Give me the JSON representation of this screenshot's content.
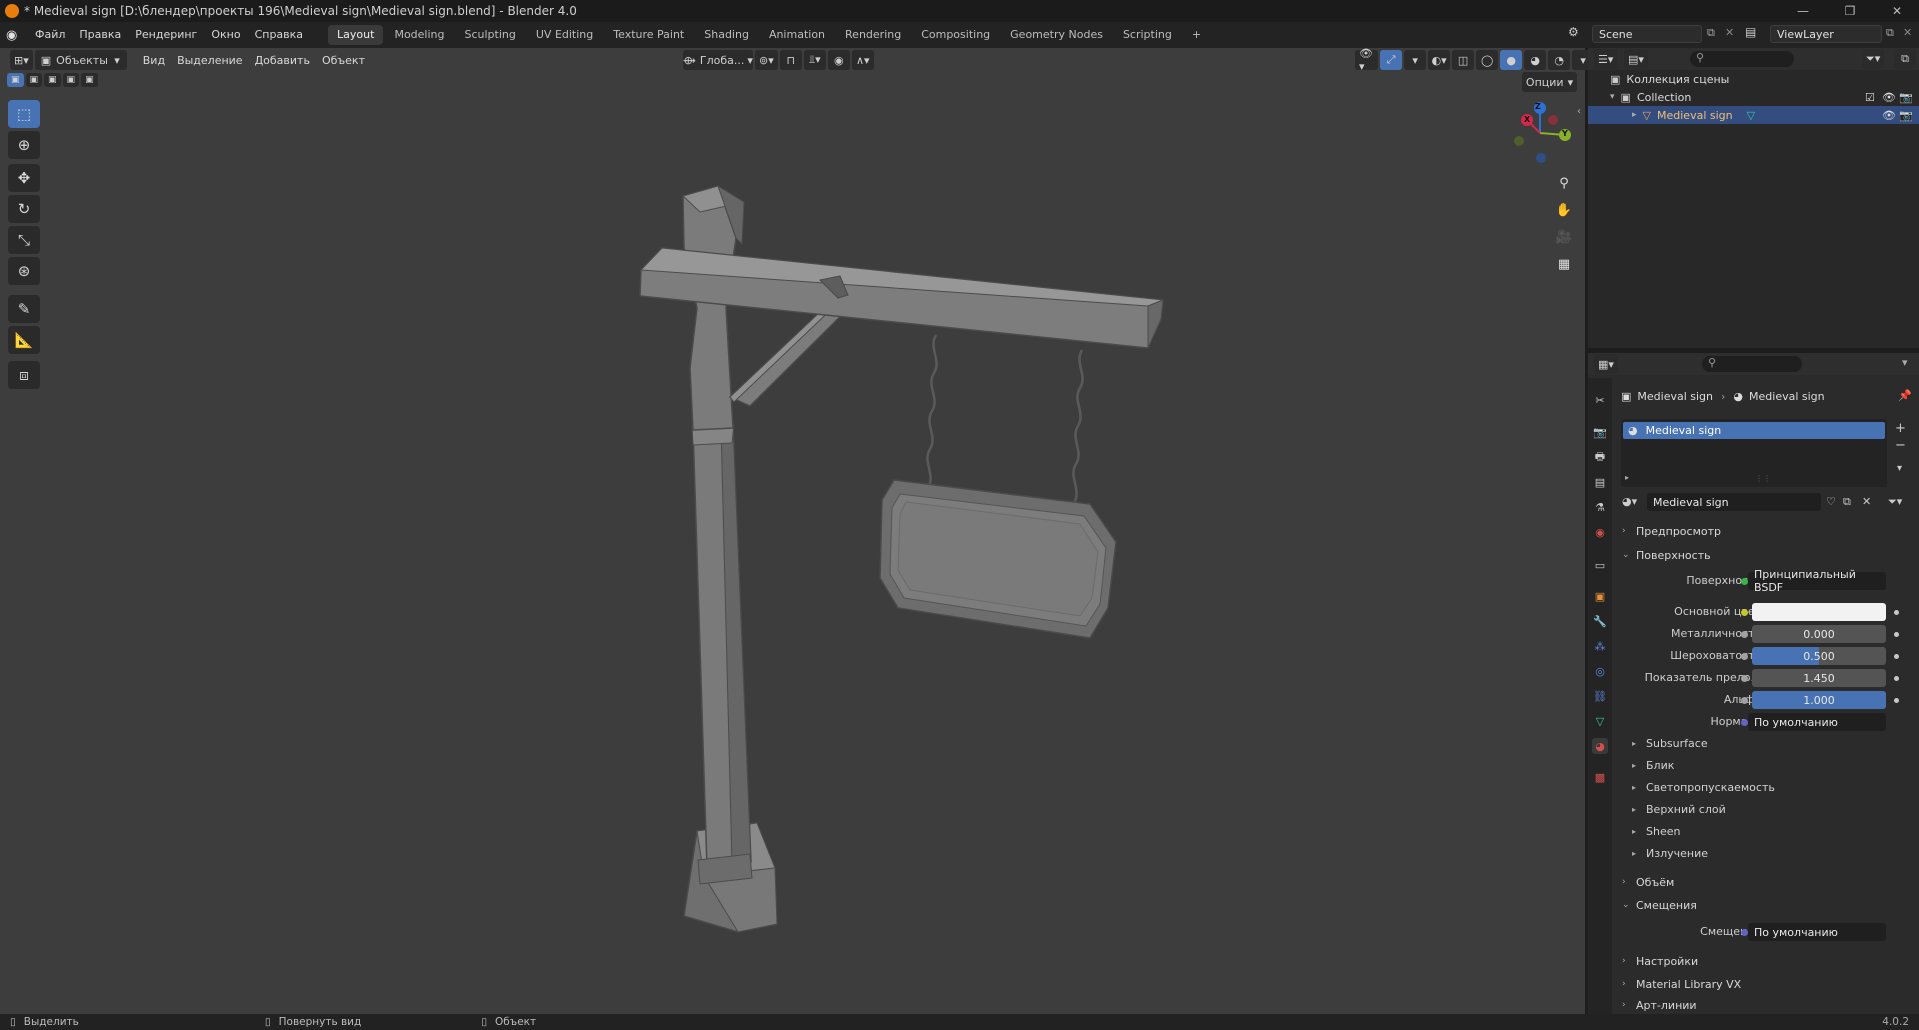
{
  "window": {
    "title": "* Medieval sign [D:\\блендер\\проекты 196\\Medieval sign\\Medieval sign.blend] - Blender 4.0",
    "minimize": "—",
    "maximize": "❐",
    "close": "✕"
  },
  "menu": [
    "Файл",
    "Правка",
    "Рендеринг",
    "Окно",
    "Справка"
  ],
  "workspaces": [
    "Layout",
    "Modeling",
    "Sculpting",
    "UV Editing",
    "Texture Paint",
    "Shading",
    "Animation",
    "Rendering",
    "Compositing",
    "Geometry Nodes",
    "Scripting"
  ],
  "workspace_add": "+",
  "scene": {
    "name": "Scene",
    "view_layer": "ViewLayer"
  },
  "viewport": {
    "mode": "Объекты",
    "menus": [
      "Вид",
      "Выделение",
      "Добавить",
      "Объект"
    ],
    "transform_orientation": "Глоба...",
    "options": "Опции"
  },
  "gizmo": {
    "x": "X",
    "y": "Y",
    "z": "Z"
  },
  "outliner": {
    "search_placeholder": "",
    "scene_collection": "Коллекция сцены",
    "collection": "Collection",
    "object": "Medieval sign"
  },
  "properties": {
    "breadcrumb_object": "Medieval sign",
    "breadcrumb_material": "Medieval sign",
    "slot_name": "Medieval sign",
    "material_name": "Medieval sign",
    "sections": {
      "preview": "Предпросмотр",
      "surface": "Поверхность",
      "volume": "Объём",
      "displacement": "Смещения",
      "settings": "Настройки",
      "material_library": "Material Library VX",
      "lineart": "Арт-линии"
    },
    "surface_label": "Поверхность",
    "surface_value": "Принципиальный BSDF",
    "fields": {
      "base_color": "Основной цвет",
      "metallic_label": "Металличность",
      "metallic": "0.000",
      "roughness_label": "Шероховатость",
      "roughness": "0.500",
      "ior_label": "Показатель прело...",
      "ior": "1.450",
      "alpha_label": "Альфа",
      "alpha": "1.000",
      "normal_label": "Нормаль",
      "normal": "По умолчанию"
    },
    "subpanels": [
      "Subsurface",
      "Блик",
      "Светопропускаемость",
      "Верхний слой",
      "Sheen",
      "Излучение"
    ],
    "displacement_label": "Смещения",
    "displacement_value": "По умолчанию"
  },
  "statusbar": {
    "select": "Выделить",
    "rotate": "Повернуть вид",
    "object": "Объект",
    "version": "4.0.2"
  },
  "colors": {
    "accent": "#4772b3",
    "viewport_bg": "#3d3d3d",
    "socket_yellow": "#c7c729",
    "socket_gray": "#a1a1a1",
    "socket_purple": "#6363c7"
  }
}
